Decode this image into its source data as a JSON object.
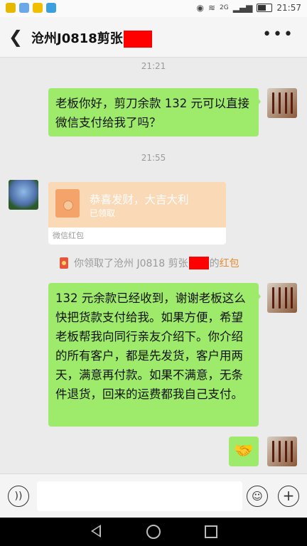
{
  "status_bar": {
    "time": "21:57",
    "network": "2G"
  },
  "header": {
    "title": "沧州J0818剪张",
    "back_icon": "chevron-left-icon",
    "more_icon": "more-dots-icon"
  },
  "messages": [
    {
      "time": "21:21"
    },
    {
      "text": "老板你好，剪刀余款 132 元可以直接微信支付给我了吗？"
    },
    {
      "time": "21:55"
    },
    {
      "red_packet": {
        "title": "恭喜发财，大吉大利",
        "status": "已领取",
        "footer": "微信红包"
      }
    },
    {
      "notice": {
        "prefix": "你领取了沧州 J0818 剪张",
        "suffix": "的",
        "link": "红包"
      }
    },
    {
      "text": "132 元余款已经收到，谢谢老板这么快把货款支付给我。如果方便，希望老板帮我向同行亲友介绍下。你介绍的所有客户，都是先发货，客户用两天，满意再付款。如果不满意，无条件退货，回来的运费都我自己支付。"
    },
    {
      "emoji": "🤝"
    }
  ],
  "input_bar": {
    "voice_icon": "voice-icon",
    "emoji_icon": "emoji-icon",
    "plus_icon": "plus-icon"
  },
  "colors": {
    "bubble_green": "#9eea6a",
    "red_packet": "#fad9b6",
    "link_orange": "#e88b2e",
    "redact": "#ff0000"
  }
}
